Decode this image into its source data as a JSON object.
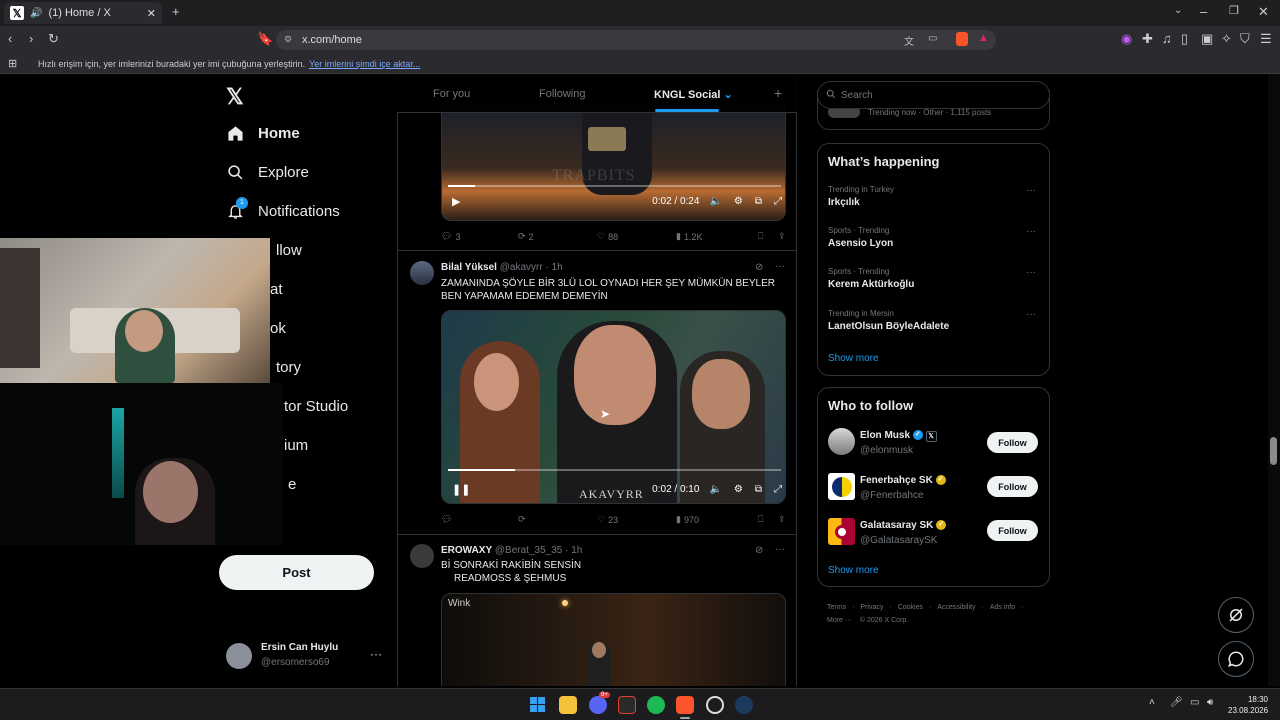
{
  "browser": {
    "tab_title": "(1) Home / X",
    "url": "x.com/home",
    "bookmarks_bar_text": "Hızlı erişim için, yer imlerinizi buradaki yer imi çubuğuna yerleştirin.",
    "bookmarks_bar_link": "Yer imlerini şimdi içe aktar..."
  },
  "nav": {
    "items": [
      {
        "label": "Home"
      },
      {
        "label": "Explore"
      },
      {
        "label": "Notifications",
        "badge": "1"
      },
      {
        "label": "llow"
      },
      {
        "label": "at"
      },
      {
        "label": "ok"
      },
      {
        "label": "tory"
      },
      {
        "label": "tor Studio"
      },
      {
        "label": "ium"
      },
      {
        "label": "e"
      }
    ],
    "post_label": "Post",
    "user": {
      "name": "Ersin Can Huylu",
      "handle": "@ersomerso69"
    }
  },
  "timeline": {
    "tabs": [
      "For you",
      "Following",
      "KNGL Social"
    ],
    "active_tab": "KNGL Social",
    "tweets": [
      {
        "video_time": "0:02 / 0:24",
        "video_watermark": "TRAPBITS",
        "replies": "3",
        "reposts": "2",
        "likes": "88",
        "views": "1.2K"
      },
      {
        "name": "Bilal Yüksel",
        "handle": "@akavyrr",
        "time": "· 1h",
        "text": "ZAMANINDA ŞÖYLE BİR 3LÜ LOL OYNADI HER ŞEY MÜMKÜN BEYLER BEN YAPAMAM EDEMEM DEMEYİN",
        "video_time": "0:02 / 0:10",
        "video_watermark": "AKAVYRR",
        "replies": "",
        "reposts": "",
        "likes": "23",
        "views": "970"
      },
      {
        "name": "EROWAXY",
        "handle": "@Berat_35_35",
        "time": "· 1h",
        "text_line1": "Bİ SONRAKİ RAKİBİN SENSİN",
        "text_line2": "READMOSS & ŞEHMUS",
        "video_watermark": "Wink"
      }
    ]
  },
  "sidebar": {
    "search_placeholder": "Search",
    "top_clip_text": "Trending now · Other · 1,115 posts",
    "whats_happening": {
      "title": "What’s happening",
      "trends": [
        {
          "meta": "Trending in Turkey",
          "name": "Irkçılık"
        },
        {
          "meta": "Sports · Trending",
          "name": "Asensio Lyon"
        },
        {
          "meta": "Sports · Trending",
          "name": "Kerem Aktürkoğlu"
        },
        {
          "meta": "Trending in Mersin",
          "name": "LanetOlsun BöyleAdalete"
        }
      ],
      "show_more": "Show more"
    },
    "who_to_follow": {
      "title": "Who to follow",
      "accounts": [
        {
          "name": "Elon Musk",
          "handle": "@elonmusk",
          "follow": "Follow"
        },
        {
          "name": "Fenerbahçe SK",
          "handle": "@Fenerbahce",
          "follow": "Follow"
        },
        {
          "name": "Galatasaray SK",
          "handle": "@GalatasaraySK",
          "follow": "Follow"
        }
      ],
      "show_more": "Show more"
    },
    "footer": {
      "line1": [
        "Terms",
        "Privacy",
        "Cookies",
        "Accessibility",
        "Ads info"
      ],
      "more": "More ···",
      "copyright": "© 2026 X Corp."
    }
  },
  "taskbar": {
    "time": "18:30",
    "date": "23.08.2026",
    "discord_badge": "9+"
  },
  "colors": {
    "accent": "#1d9bf0",
    "border": "#2f3336",
    "muted": "#71767b"
  }
}
